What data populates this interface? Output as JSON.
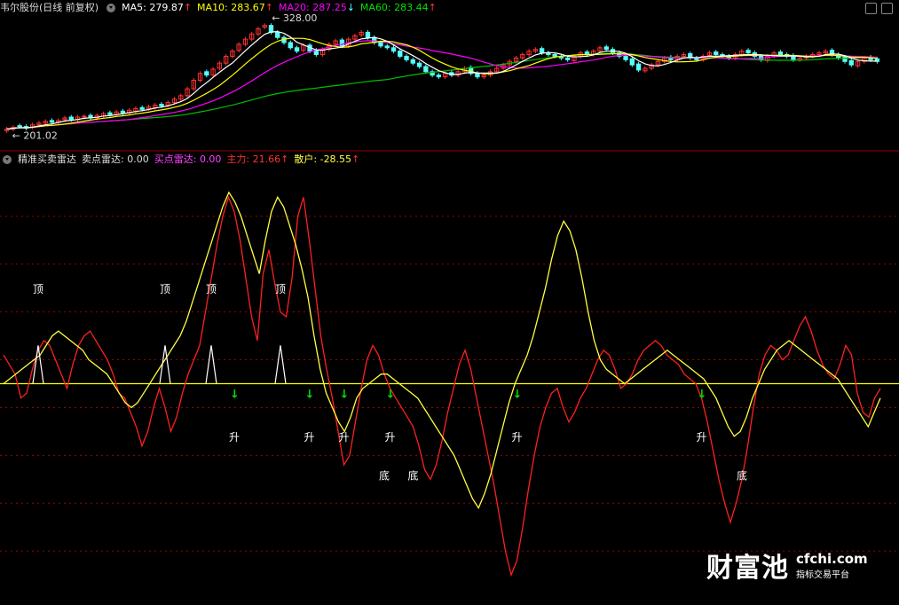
{
  "header_top": {
    "stock_name": "韦尔股份(日线 前复权)",
    "ma5": {
      "label": "MA5:",
      "value": "279.87",
      "dir": "↑"
    },
    "ma10": {
      "label": "MA10:",
      "value": "283.67",
      "dir": "↑"
    },
    "ma20": {
      "label": "MA20:",
      "value": "287.25",
      "dir": "↓"
    },
    "ma60": {
      "label": "MA60:",
      "value": "283.44",
      "dir": "↑"
    }
  },
  "header_bottom": {
    "indicator_name": "精准买卖雷达",
    "sell_radar": {
      "label": "卖点雷达:",
      "value": "0.00"
    },
    "buy_radar": {
      "label": "买点雷达:",
      "value": "0.00"
    },
    "main_force": {
      "label": "主力:",
      "value": "21.66",
      "dir": "↑"
    },
    "retail": {
      "label": "散户:",
      "value": "-28.55",
      "dir": "↑"
    }
  },
  "colors": {
    "up": "#ff3232",
    "down": "#54ffff",
    "ma5": "#ffffff",
    "ma10": "#ffff00",
    "ma20": "#ff00ff",
    "ma60": "#00c000",
    "main_force": "#ff2020",
    "retail": "#ffff40",
    "zero_line": "#ffff00",
    "grid": "#a00000",
    "signal_green": "#00e000",
    "label_white": "#ffffff"
  },
  "chart_data": [
    {
      "type": "candlestick",
      "high_label": "328.00",
      "low_label": "201.02",
      "ylim": [
        190,
        335
      ],
      "closes": [
        205,
        207,
        208,
        206,
        210,
        212,
        214,
        213,
        215,
        218,
        216,
        219,
        220,
        218,
        221,
        223,
        222,
        225,
        224,
        227,
        229,
        228,
        231,
        233,
        232,
        236,
        240,
        244,
        252,
        262,
        270,
        268,
        275,
        282,
        290,
        296,
        304,
        310,
        316,
        322,
        326,
        318,
        312,
        306,
        300,
        296,
        303,
        296,
        292,
        298,
        304,
        308,
        302,
        310,
        314,
        318,
        312,
        306,
        302,
        300,
        296,
        290,
        286,
        282,
        278,
        272,
        268,
        266,
        270,
        268,
        272,
        276,
        270,
        266,
        268,
        272,
        276,
        280,
        284,
        288,
        292,
        296,
        298,
        294,
        292,
        290,
        288,
        286,
        290,
        294,
        292,
        296,
        300,
        298,
        294,
        290,
        286,
        280,
        274,
        276,
        280,
        284,
        288,
        286,
        290,
        292,
        288,
        286,
        290,
        294,
        292,
        290,
        288,
        292,
        296,
        294,
        290,
        286,
        290,
        294,
        292,
        290,
        286,
        288,
        290,
        292,
        294,
        296,
        292,
        288,
        284,
        280,
        284,
        288,
        286,
        284
      ],
      "opens": [
        203,
        205,
        209,
        208,
        207,
        210,
        212,
        215,
        213,
        216,
        219,
        216,
        219,
        221,
        218,
        220,
        224,
        222,
        226,
        224,
        226,
        230,
        229,
        230,
        234,
        233,
        236,
        240,
        244,
        252,
        262,
        272,
        268,
        276,
        282,
        290,
        297,
        304,
        310,
        316,
        324,
        326,
        318,
        312,
        306,
        300,
        297,
        303,
        297,
        292,
        298,
        304,
        309,
        302,
        310,
        315,
        318,
        312,
        306,
        302,
        300,
        296,
        290,
        286,
        282,
        278,
        272,
        268,
        266,
        271,
        268,
        272,
        277,
        270,
        266,
        268,
        272,
        276,
        280,
        284,
        288,
        292,
        296,
        299,
        294,
        292,
        290,
        288,
        285,
        290,
        295,
        292,
        296,
        301,
        298,
        294,
        290,
        287,
        281,
        273,
        276,
        280,
        284,
        289,
        286,
        290,
        293,
        288,
        286,
        291,
        295,
        292,
        290,
        288,
        292,
        297,
        294,
        290,
        285,
        290,
        295,
        292,
        291,
        286,
        288,
        290,
        292,
        294,
        297,
        292,
        289,
        285,
        279,
        284,
        289,
        287
      ]
    },
    {
      "type": "line",
      "series": [
        {
          "name": "主力",
          "values": [
            12,
            8,
            4,
            -6,
            -4,
            6,
            14,
            18,
            16,
            10,
            4,
            -2,
            8,
            16,
            20,
            22,
            18,
            14,
            10,
            4,
            -4,
            -6,
            -12,
            -18,
            -26,
            -20,
            -10,
            -2,
            -10,
            -20,
            -14,
            -4,
            4,
            10,
            16,
            30,
            44,
            58,
            70,
            78,
            72,
            60,
            44,
            28,
            18,
            46,
            56,
            42,
            30,
            28,
            44,
            70,
            78,
            60,
            40,
            20,
            6,
            -6,
            -20,
            -34,
            -30,
            -16,
            -2,
            10,
            16,
            12,
            4,
            -2,
            -6,
            -10,
            -14,
            -18,
            -26,
            -36,
            -40,
            -34,
            -24,
            -12,
            -2,
            8,
            14,
            6,
            -6,
            -18,
            -30,
            -42,
            -56,
            -70,
            -80,
            -74,
            -60,
            -44,
            -30,
            -18,
            -10,
            -4,
            -2,
            -10,
            -16,
            -12,
            -6,
            -2,
            4,
            10,
            14,
            12,
            6,
            -2,
            0,
            4,
            10,
            14,
            16,
            18,
            16,
            12,
            10,
            8,
            4,
            2,
            0,
            -6,
            -16,
            -28,
            -40,
            -50,
            -58,
            -50,
            -40,
            -26,
            -10,
            4,
            12,
            16,
            14,
            10,
            12,
            18,
            24,
            28,
            22,
            14,
            8,
            4,
            2,
            8,
            16,
            12,
            -4,
            -12,
            -14,
            -6,
            -2
          ],
          "signals_top": [
            6,
            28,
            36,
            48
          ],
          "signals_bottom_rise": [
            40,
            53,
            59,
            67,
            89,
            121
          ]
        },
        {
          "name": "散户",
          "values": [
            0,
            2,
            4,
            6,
            8,
            10,
            12,
            16,
            20,
            22,
            20,
            18,
            16,
            14,
            10,
            8,
            6,
            4,
            0,
            -4,
            -8,
            -10,
            -8,
            -4,
            0,
            4,
            8,
            12,
            16,
            20,
            26,
            34,
            42,
            50,
            58,
            66,
            74,
            80,
            76,
            70,
            62,
            54,
            46,
            60,
            72,
            78,
            74,
            66,
            58,
            48,
            36,
            20,
            6,
            -4,
            -10,
            -16,
            -20,
            -14,
            -6,
            -2,
            0,
            2,
            4,
            4,
            2,
            0,
            -2,
            -4,
            -6,
            -10,
            -14,
            -18,
            -22,
            -26,
            -30,
            -36,
            -42,
            -48,
            -52,
            -46,
            -38,
            -28,
            -18,
            -8,
            0,
            6,
            12,
            20,
            30,
            40,
            52,
            62,
            68,
            64,
            56,
            44,
            30,
            18,
            10,
            6,
            4,
            2,
            0,
            2,
            4,
            6,
            8,
            10,
            12,
            14,
            12,
            10,
            8,
            6,
            4,
            2,
            -2,
            -6,
            -12,
            -18,
            -22,
            -20,
            -14,
            -6,
            0,
            6,
            10,
            14,
            16,
            18,
            16,
            14,
            12,
            10,
            8,
            6,
            4,
            2,
            -2,
            -6,
            -10,
            -14,
            -18,
            -12,
            -6
          ]
        }
      ],
      "zero_line": 0,
      "ylim": [
        -90,
        90
      ],
      "labels": {
        "top": "顶",
        "bottom": "底",
        "rise": "升"
      }
    }
  ],
  "watermark": {
    "brand": "财富池",
    "domain": "cfchi.com",
    "tagline": "指标交易平台"
  }
}
